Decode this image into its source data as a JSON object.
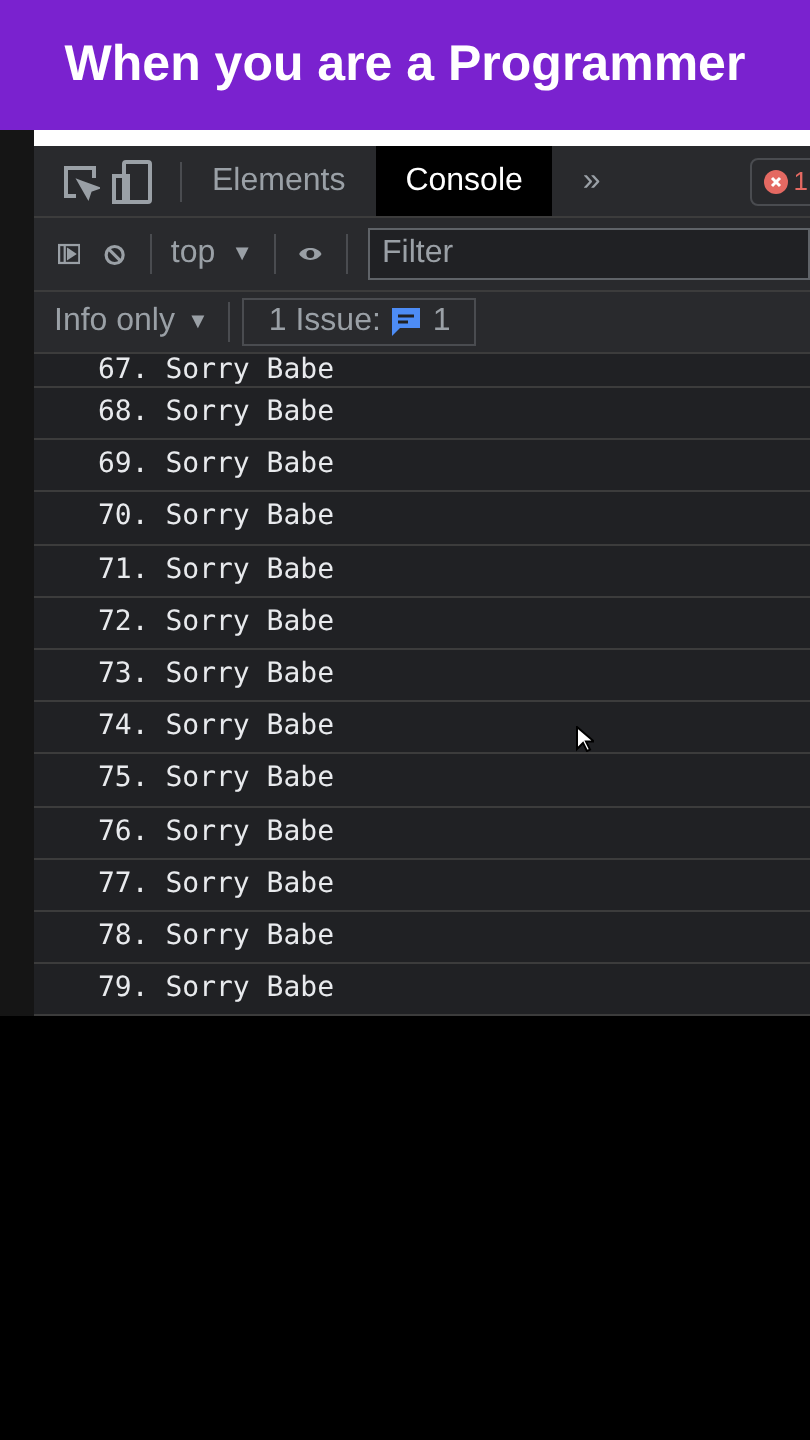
{
  "caption": "When you are a Programmer",
  "tabs": [
    {
      "label": "Elements",
      "selected": false
    },
    {
      "label": "Console",
      "selected": true
    },
    {
      "label": "»",
      "selected": false
    }
  ],
  "error_badge": {
    "count": "1"
  },
  "console_toolbar": {
    "context": "top",
    "context_caret": "▼",
    "filter": {
      "placeholder": "Filter"
    }
  },
  "levels": {
    "label": "Info only",
    "caret": "▼"
  },
  "issues": {
    "label": "1 Issue:",
    "count": "1"
  },
  "log": [
    "67. Sorry Babe",
    "68. Sorry Babe",
    "69. Sorry Babe",
    "70. Sorry Babe",
    "71. Sorry Babe",
    "72. Sorry Babe",
    "73. Sorry Babe",
    "74. Sorry Babe",
    "75. Sorry Babe",
    "76. Sorry Babe",
    "77. Sorry Babe",
    "78. Sorry Babe",
    "79. Sorry Babe"
  ]
}
